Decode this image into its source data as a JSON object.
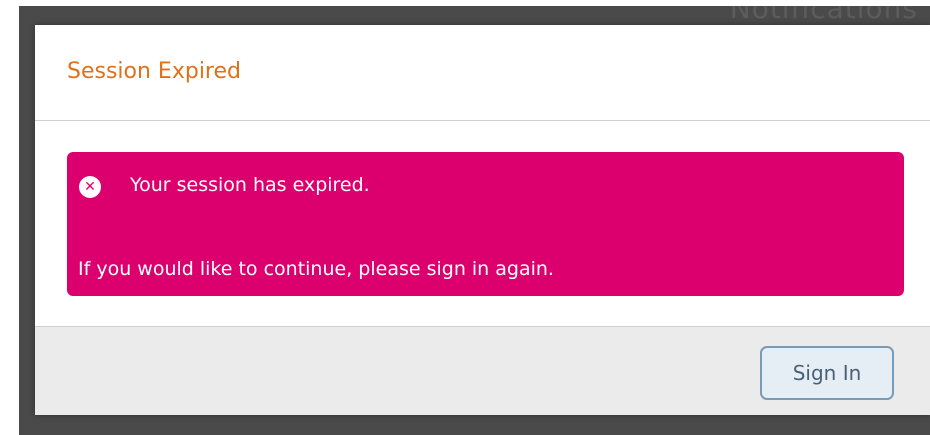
{
  "backdrop": {
    "heading": "Notifications"
  },
  "modal": {
    "title": "Session Expired",
    "alert": {
      "icon": "error-circle-x-icon",
      "icon_glyph": "✕",
      "message": "Your session has expired.",
      "detail": "If you would like to continue, please sign in again.",
      "color": "#dc006e"
    },
    "footer": {
      "sign_in_label": "Sign In"
    }
  },
  "colors": {
    "title": "#e0711b",
    "alert_background": "#dc006e",
    "button_border": "#7a9bb5",
    "button_background": "#e6eef5",
    "footer_background": "#ebebeb"
  }
}
